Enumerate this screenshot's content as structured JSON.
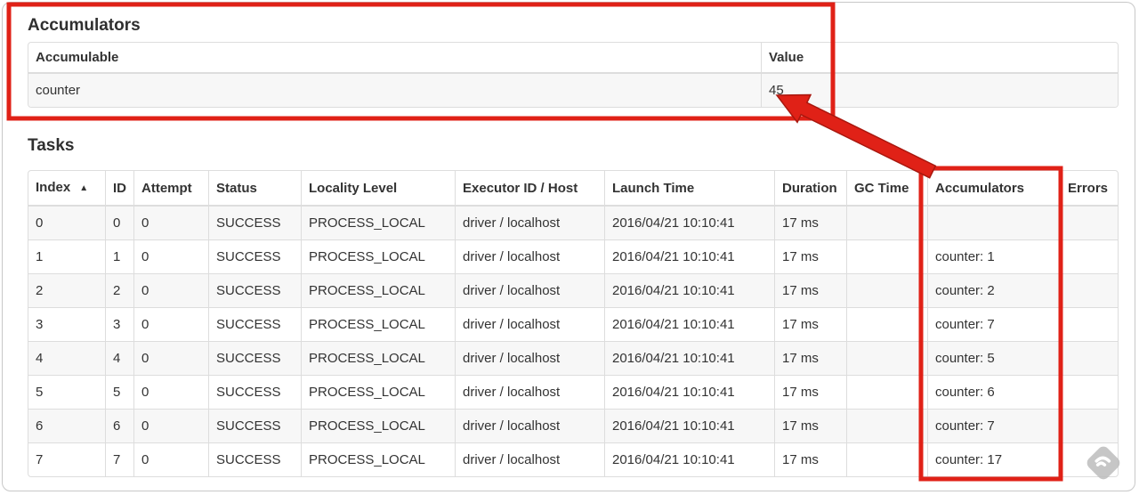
{
  "accumulators_section": {
    "title": "Accumulators",
    "table": {
      "columns": [
        {
          "key": "accumulable",
          "label": "Accumulable"
        },
        {
          "key": "value",
          "label": "Value"
        }
      ],
      "rows": [
        {
          "accumulable": "counter",
          "value": "45"
        }
      ]
    }
  },
  "tasks_section": {
    "title": "Tasks",
    "table": {
      "columns": [
        {
          "key": "index",
          "label": "Index",
          "sorted": "asc",
          "sort_indicator": "▲"
        },
        {
          "key": "id",
          "label": "ID"
        },
        {
          "key": "attempt",
          "label": "Attempt"
        },
        {
          "key": "status",
          "label": "Status"
        },
        {
          "key": "locality_level",
          "label": "Locality Level"
        },
        {
          "key": "executor_id_host",
          "label": "Executor ID / Host"
        },
        {
          "key": "launch_time",
          "label": "Launch Time"
        },
        {
          "key": "duration",
          "label": "Duration"
        },
        {
          "key": "gc_time",
          "label": "GC Time"
        },
        {
          "key": "accumulators",
          "label": "Accumulators"
        },
        {
          "key": "errors",
          "label": "Errors"
        }
      ],
      "rows": [
        {
          "index": "0",
          "id": "0",
          "attempt": "0",
          "status": "SUCCESS",
          "locality_level": "PROCESS_LOCAL",
          "executor_id_host": "driver / localhost",
          "launch_time": "2016/04/21 10:10:41",
          "duration": "17 ms",
          "gc_time": "",
          "accumulators": "",
          "errors": ""
        },
        {
          "index": "1",
          "id": "1",
          "attempt": "0",
          "status": "SUCCESS",
          "locality_level": "PROCESS_LOCAL",
          "executor_id_host": "driver / localhost",
          "launch_time": "2016/04/21 10:10:41",
          "duration": "17 ms",
          "gc_time": "",
          "accumulators": "counter: 1",
          "errors": ""
        },
        {
          "index": "2",
          "id": "2",
          "attempt": "0",
          "status": "SUCCESS",
          "locality_level": "PROCESS_LOCAL",
          "executor_id_host": "driver / localhost",
          "launch_time": "2016/04/21 10:10:41",
          "duration": "17 ms",
          "gc_time": "",
          "accumulators": "counter: 2",
          "errors": ""
        },
        {
          "index": "3",
          "id": "3",
          "attempt": "0",
          "status": "SUCCESS",
          "locality_level": "PROCESS_LOCAL",
          "executor_id_host": "driver / localhost",
          "launch_time": "2016/04/21 10:10:41",
          "duration": "17 ms",
          "gc_time": "",
          "accumulators": "counter: 7",
          "errors": ""
        },
        {
          "index": "4",
          "id": "4",
          "attempt": "0",
          "status": "SUCCESS",
          "locality_level": "PROCESS_LOCAL",
          "executor_id_host": "driver / localhost",
          "launch_time": "2016/04/21 10:10:41",
          "duration": "17 ms",
          "gc_time": "",
          "accumulators": "counter: 5",
          "errors": ""
        },
        {
          "index": "5",
          "id": "5",
          "attempt": "0",
          "status": "SUCCESS",
          "locality_level": "PROCESS_LOCAL",
          "executor_id_host": "driver / localhost",
          "launch_time": "2016/04/21 10:10:41",
          "duration": "17 ms",
          "gc_time": "",
          "accumulators": "counter: 6",
          "errors": ""
        },
        {
          "index": "6",
          "id": "6",
          "attempt": "0",
          "status": "SUCCESS",
          "locality_level": "PROCESS_LOCAL",
          "executor_id_host": "driver / localhost",
          "launch_time": "2016/04/21 10:10:41",
          "duration": "17 ms",
          "gc_time": "",
          "accumulators": "counter: 7",
          "errors": ""
        },
        {
          "index": "7",
          "id": "7",
          "attempt": "0",
          "status": "SUCCESS",
          "locality_level": "PROCESS_LOCAL",
          "executor_id_host": "driver / localhost",
          "launch_time": "2016/04/21 10:10:41",
          "duration": "17 ms",
          "gc_time": "",
          "accumulators": "counter: 17",
          "errors": ""
        }
      ]
    }
  },
  "annotations": {
    "highlight_color": "#e02117",
    "box_names": [
      "accumulators-section-highlight",
      "accumulators-column-highlight"
    ],
    "arrow_points_to": "45"
  },
  "watermark": {
    "icon": "feedly-logo-icon",
    "color": "#bdbdbd"
  }
}
